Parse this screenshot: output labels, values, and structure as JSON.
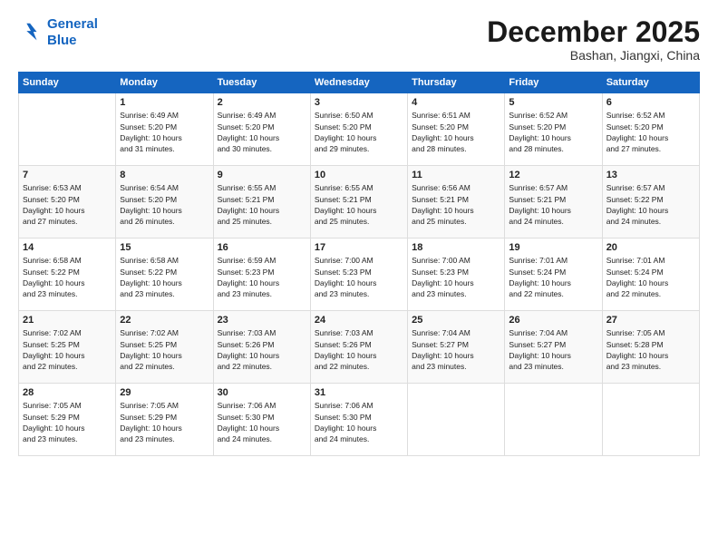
{
  "logo": {
    "line1": "General",
    "line2": "Blue"
  },
  "title": "December 2025",
  "location": "Bashan, Jiangxi, China",
  "weekdays": [
    "Sunday",
    "Monday",
    "Tuesday",
    "Wednesday",
    "Thursday",
    "Friday",
    "Saturday"
  ],
  "weeks": [
    [
      {
        "day": "",
        "info": ""
      },
      {
        "day": "1",
        "info": "Sunrise: 6:49 AM\nSunset: 5:20 PM\nDaylight: 10 hours\nand 31 minutes."
      },
      {
        "day": "2",
        "info": "Sunrise: 6:49 AM\nSunset: 5:20 PM\nDaylight: 10 hours\nand 30 minutes."
      },
      {
        "day": "3",
        "info": "Sunrise: 6:50 AM\nSunset: 5:20 PM\nDaylight: 10 hours\nand 29 minutes."
      },
      {
        "day": "4",
        "info": "Sunrise: 6:51 AM\nSunset: 5:20 PM\nDaylight: 10 hours\nand 28 minutes."
      },
      {
        "day": "5",
        "info": "Sunrise: 6:52 AM\nSunset: 5:20 PM\nDaylight: 10 hours\nand 28 minutes."
      },
      {
        "day": "6",
        "info": "Sunrise: 6:52 AM\nSunset: 5:20 PM\nDaylight: 10 hours\nand 27 minutes."
      }
    ],
    [
      {
        "day": "7",
        "info": "Sunrise: 6:53 AM\nSunset: 5:20 PM\nDaylight: 10 hours\nand 27 minutes."
      },
      {
        "day": "8",
        "info": "Sunrise: 6:54 AM\nSunset: 5:20 PM\nDaylight: 10 hours\nand 26 minutes."
      },
      {
        "day": "9",
        "info": "Sunrise: 6:55 AM\nSunset: 5:21 PM\nDaylight: 10 hours\nand 25 minutes."
      },
      {
        "day": "10",
        "info": "Sunrise: 6:55 AM\nSunset: 5:21 PM\nDaylight: 10 hours\nand 25 minutes."
      },
      {
        "day": "11",
        "info": "Sunrise: 6:56 AM\nSunset: 5:21 PM\nDaylight: 10 hours\nand 25 minutes."
      },
      {
        "day": "12",
        "info": "Sunrise: 6:57 AM\nSunset: 5:21 PM\nDaylight: 10 hours\nand 24 minutes."
      },
      {
        "day": "13",
        "info": "Sunrise: 6:57 AM\nSunset: 5:22 PM\nDaylight: 10 hours\nand 24 minutes."
      }
    ],
    [
      {
        "day": "14",
        "info": "Sunrise: 6:58 AM\nSunset: 5:22 PM\nDaylight: 10 hours\nand 23 minutes."
      },
      {
        "day": "15",
        "info": "Sunrise: 6:58 AM\nSunset: 5:22 PM\nDaylight: 10 hours\nand 23 minutes."
      },
      {
        "day": "16",
        "info": "Sunrise: 6:59 AM\nSunset: 5:23 PM\nDaylight: 10 hours\nand 23 minutes."
      },
      {
        "day": "17",
        "info": "Sunrise: 7:00 AM\nSunset: 5:23 PM\nDaylight: 10 hours\nand 23 minutes."
      },
      {
        "day": "18",
        "info": "Sunrise: 7:00 AM\nSunset: 5:23 PM\nDaylight: 10 hours\nand 23 minutes."
      },
      {
        "day": "19",
        "info": "Sunrise: 7:01 AM\nSunset: 5:24 PM\nDaylight: 10 hours\nand 22 minutes."
      },
      {
        "day": "20",
        "info": "Sunrise: 7:01 AM\nSunset: 5:24 PM\nDaylight: 10 hours\nand 22 minutes."
      }
    ],
    [
      {
        "day": "21",
        "info": "Sunrise: 7:02 AM\nSunset: 5:25 PM\nDaylight: 10 hours\nand 22 minutes."
      },
      {
        "day": "22",
        "info": "Sunrise: 7:02 AM\nSunset: 5:25 PM\nDaylight: 10 hours\nand 22 minutes."
      },
      {
        "day": "23",
        "info": "Sunrise: 7:03 AM\nSunset: 5:26 PM\nDaylight: 10 hours\nand 22 minutes."
      },
      {
        "day": "24",
        "info": "Sunrise: 7:03 AM\nSunset: 5:26 PM\nDaylight: 10 hours\nand 22 minutes."
      },
      {
        "day": "25",
        "info": "Sunrise: 7:04 AM\nSunset: 5:27 PM\nDaylight: 10 hours\nand 23 minutes."
      },
      {
        "day": "26",
        "info": "Sunrise: 7:04 AM\nSunset: 5:27 PM\nDaylight: 10 hours\nand 23 minutes."
      },
      {
        "day": "27",
        "info": "Sunrise: 7:05 AM\nSunset: 5:28 PM\nDaylight: 10 hours\nand 23 minutes."
      }
    ],
    [
      {
        "day": "28",
        "info": "Sunrise: 7:05 AM\nSunset: 5:29 PM\nDaylight: 10 hours\nand 23 minutes."
      },
      {
        "day": "29",
        "info": "Sunrise: 7:05 AM\nSunset: 5:29 PM\nDaylight: 10 hours\nand 23 minutes."
      },
      {
        "day": "30",
        "info": "Sunrise: 7:06 AM\nSunset: 5:30 PM\nDaylight: 10 hours\nand 24 minutes."
      },
      {
        "day": "31",
        "info": "Sunrise: 7:06 AM\nSunset: 5:30 PM\nDaylight: 10 hours\nand 24 minutes."
      },
      {
        "day": "",
        "info": ""
      },
      {
        "day": "",
        "info": ""
      },
      {
        "day": "",
        "info": ""
      }
    ]
  ]
}
